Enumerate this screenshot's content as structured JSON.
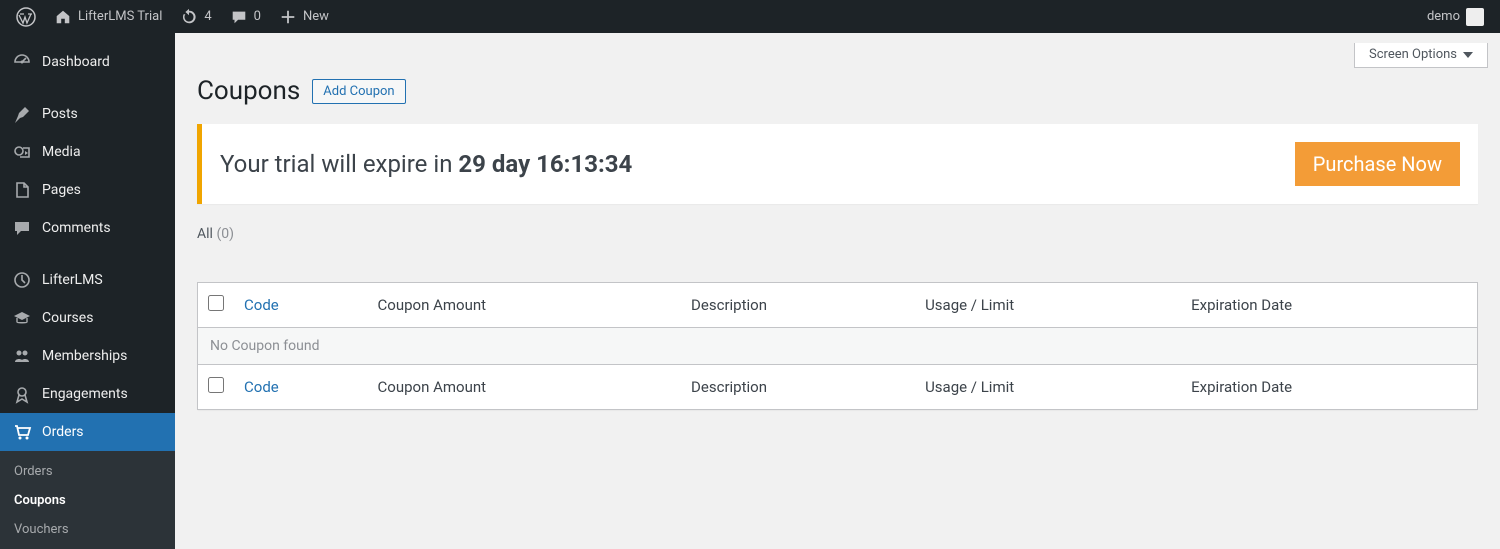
{
  "adminbar": {
    "site_title": "LifterLMS Trial",
    "updates_count": "4",
    "comments_count": "0",
    "new_label": "New",
    "user_label": "demo"
  },
  "sidebar": {
    "items": [
      {
        "label": "Dashboard",
        "icon": "dashboard-icon"
      },
      {
        "label": "Posts",
        "icon": "pin-icon"
      },
      {
        "label": "Media",
        "icon": "media-icon"
      },
      {
        "label": "Pages",
        "icon": "page-icon"
      },
      {
        "label": "Comments",
        "icon": "comment-icon"
      },
      {
        "label": "LifterLMS",
        "icon": "lifterlms-icon"
      },
      {
        "label": "Courses",
        "icon": "grad-cap-icon"
      },
      {
        "label": "Memberships",
        "icon": "group-icon"
      },
      {
        "label": "Engagements",
        "icon": "award-icon"
      },
      {
        "label": "Orders",
        "icon": "cart-icon"
      }
    ],
    "submenu": [
      {
        "label": "Orders"
      },
      {
        "label": "Coupons"
      },
      {
        "label": "Vouchers"
      }
    ]
  },
  "header": {
    "screen_options": "Screen Options",
    "page_title": "Coupons",
    "add_button": "Add Coupon"
  },
  "notice": {
    "prefix": "Your trial will expire in ",
    "bold": "29 day 16:13:34",
    "button": "Purchase Now"
  },
  "filter": {
    "all_label": "All",
    "all_count": "(0)"
  },
  "table": {
    "columns": {
      "code": "Code",
      "amount": "Coupon Amount",
      "description": "Description",
      "usage": "Usage / Limit",
      "expiration": "Expiration Date"
    },
    "empty": "No Coupon found"
  }
}
